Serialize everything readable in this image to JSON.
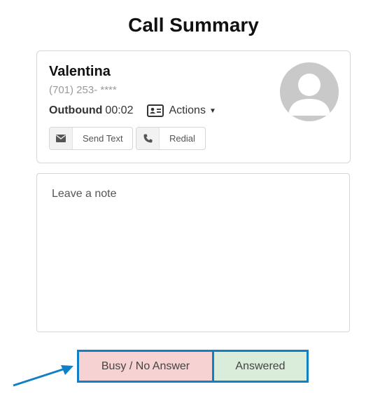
{
  "page": {
    "title": "Call Summary"
  },
  "contact": {
    "name": "Valentina",
    "phone": "(701) 253- ****",
    "call_direction": "Outbound",
    "call_duration": "00:02",
    "actions_label": "Actions",
    "avatar_icon": "user-silhouette-icon"
  },
  "buttons": {
    "send_text": "Send Text",
    "send_text_icon": "envelope-icon",
    "redial": "Redial",
    "redial_icon": "phone-icon"
  },
  "note": {
    "placeholder": "Leave a note",
    "value": ""
  },
  "outcome": {
    "busy_label": "Busy / No Answer",
    "answered_label": "Answered"
  },
  "colors": {
    "accent": "#0f7fc6",
    "busy_bg": "#f7d2d2",
    "answered_bg": "#d9edda",
    "avatar_bg": "#c9c9c9"
  }
}
